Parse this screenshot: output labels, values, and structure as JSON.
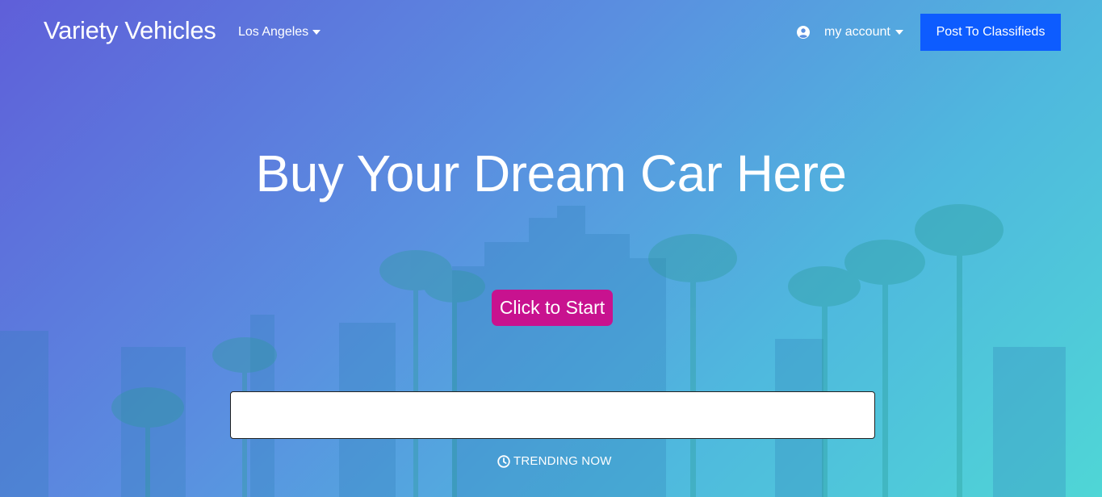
{
  "header": {
    "brand": "Variety Vehicles",
    "city": "Los Angeles",
    "account_label": "my account",
    "post_button": "Post To Classifieds"
  },
  "hero": {
    "headline": "Buy Your Dream Car Here",
    "start_button": "Click to Start",
    "search": {
      "value": "",
      "placeholder": ""
    },
    "trending_label": "TRENDING NOW"
  },
  "colors": {
    "post_button": "#0d5cff",
    "start_button": "#c8128f",
    "gradient_start": "#5f5fd9",
    "gradient_end": "#4fd6d6"
  },
  "icons": {
    "city_dropdown": "caret-down-icon",
    "account": "user-circle-icon",
    "account_dropdown": "caret-down-icon",
    "trending": "clock-icon"
  }
}
